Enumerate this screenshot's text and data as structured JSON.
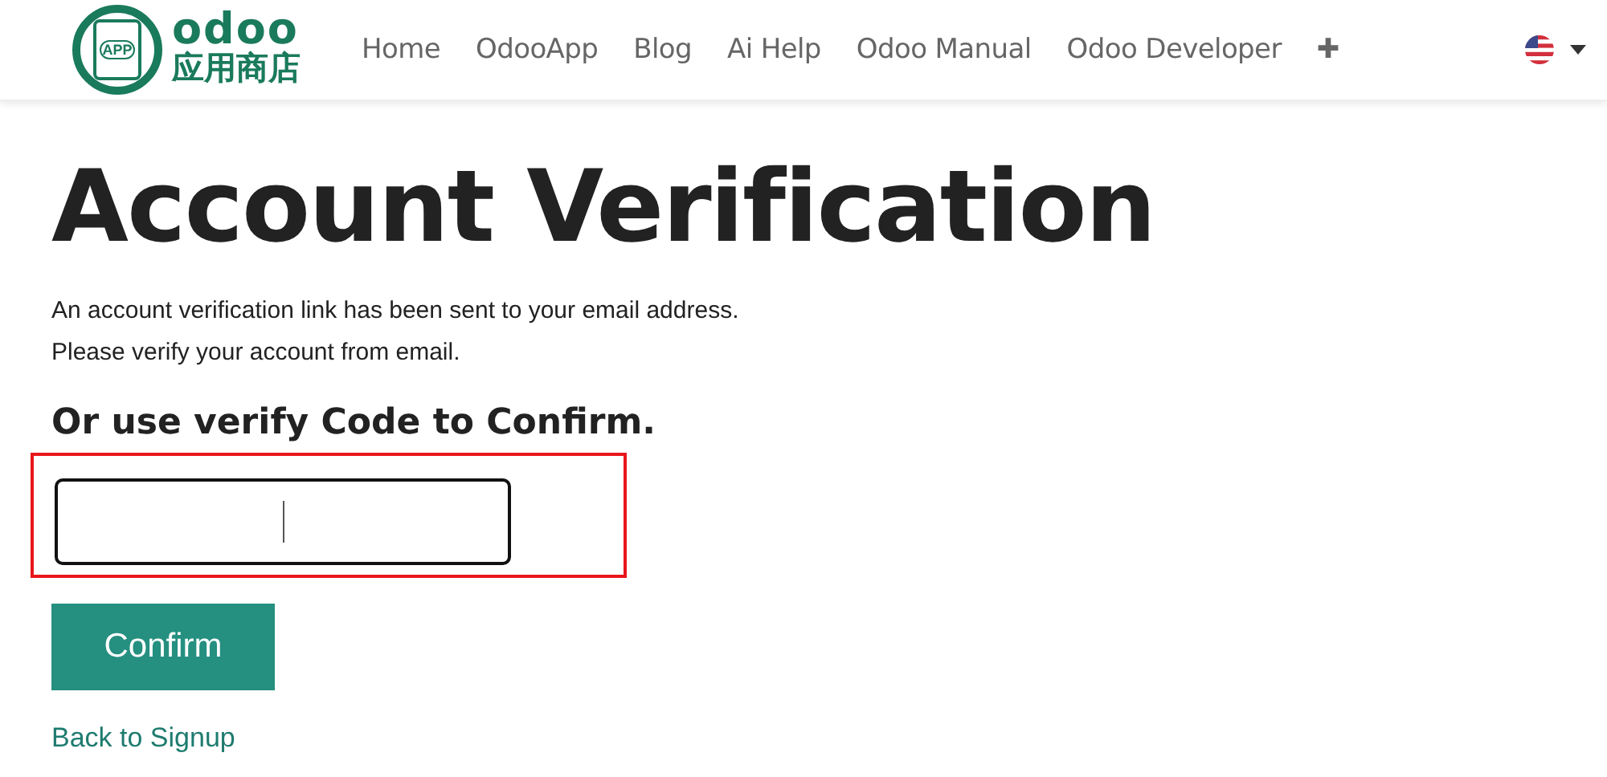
{
  "header": {
    "logo": {
      "badge": "APP",
      "wordmark": "odoo",
      "subtitle": "应用商店"
    },
    "nav": [
      {
        "label": "Home"
      },
      {
        "label": "OdooApp"
      },
      {
        "label": "Blog"
      },
      {
        "label": "Ai Help"
      },
      {
        "label": "Odoo Manual"
      },
      {
        "label": "Odoo Developer"
      },
      {
        "label": "✚"
      }
    ]
  },
  "title": "Account Verification",
  "message": [
    "An account verification link has been sent to your email address.",
    "Please verify your account from email."
  ],
  "subtitle": "Or use verify Code to Confirm.",
  "code_field": {
    "highlighted": true
  },
  "confirm_button": "Confirm",
  "back_link": "Back to Signup"
}
